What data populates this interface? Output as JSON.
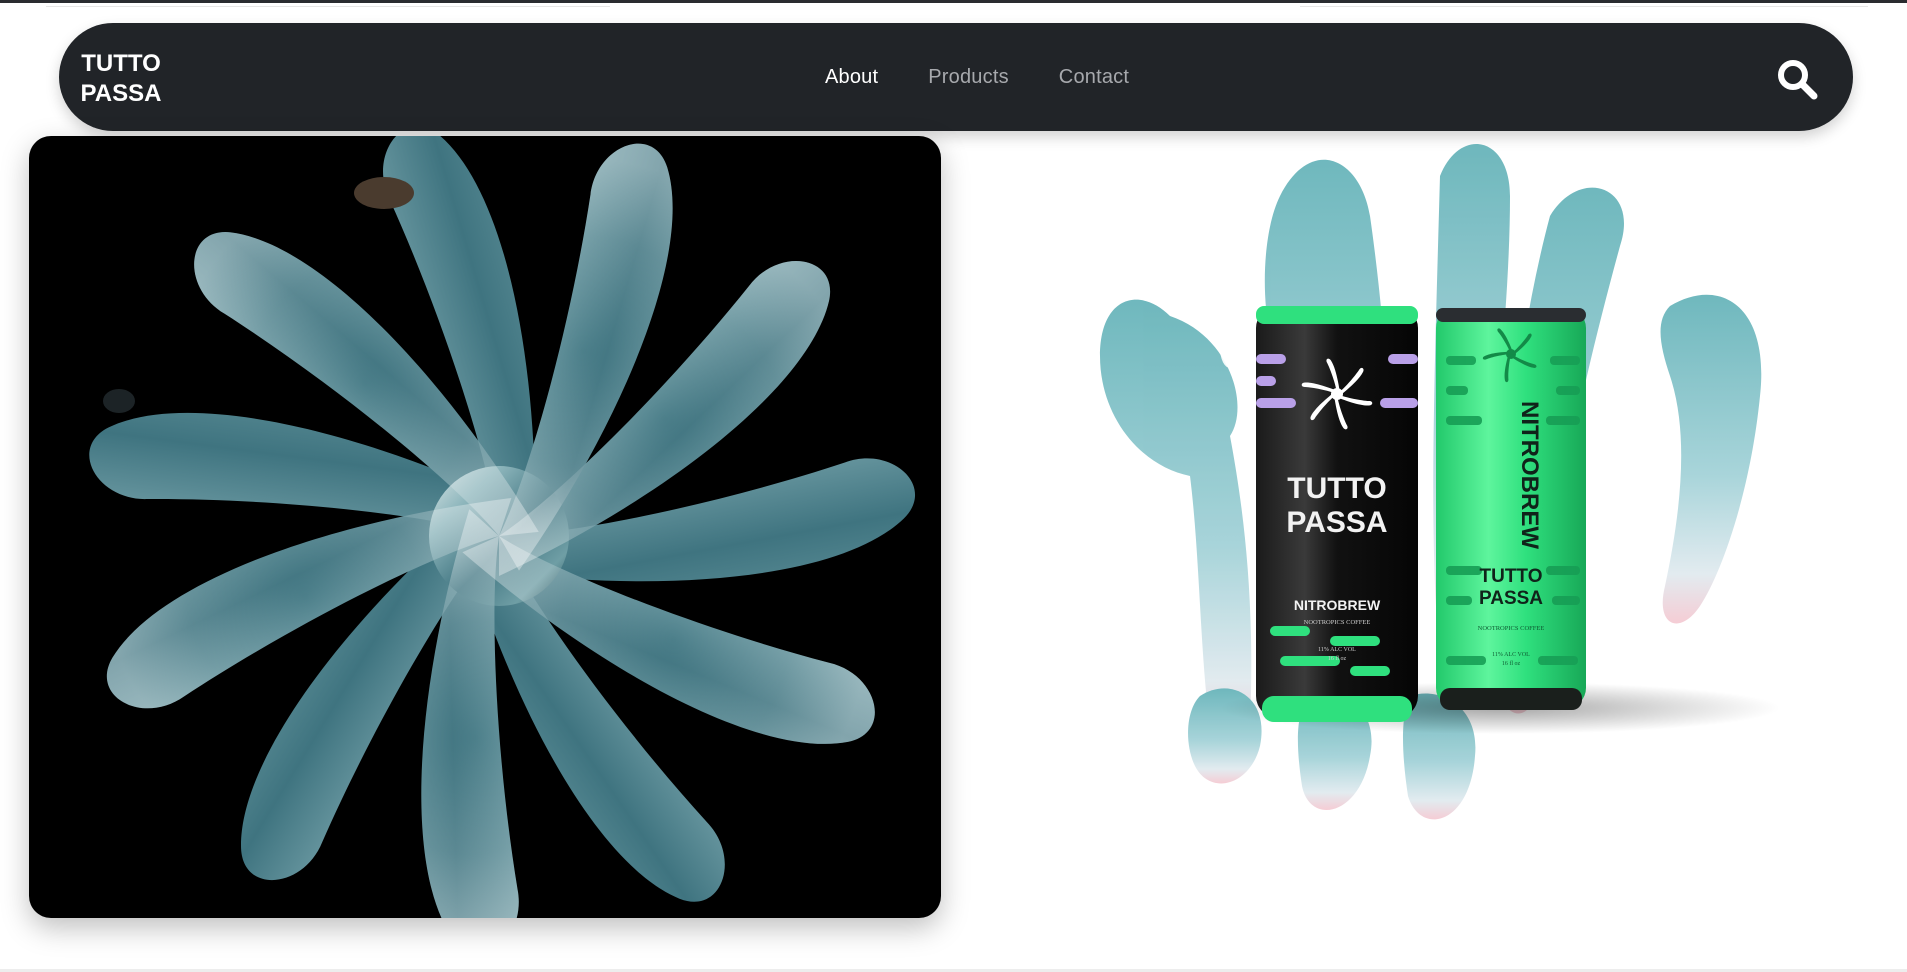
{
  "brand": {
    "logo_line1": "TUTTO",
    "logo_line2": "PASSA"
  },
  "nav": {
    "links": [
      {
        "label": "About",
        "active": true
      },
      {
        "label": "Products",
        "active": false
      },
      {
        "label": "Contact",
        "active": false
      }
    ],
    "search_icon": "search-icon"
  },
  "hero": {
    "icon": "swirl-flower-icon"
  },
  "product": {
    "backdrop_letters": [
      "P",
      "A",
      "S",
      "S",
      "A"
    ],
    "can_black": {
      "brand_line1": "TUTTO",
      "brand_line2": "PASSA",
      "product_name": "NITROBREW",
      "tagline": "NOOTROPICS COFFEE",
      "alc": "11% ALC VOL",
      "volume": "16 fl oz"
    },
    "can_green": {
      "product_name": "NITROBREW",
      "brand_line1": "TUTTO",
      "brand_line2": "PASSA",
      "tagline": "NOOTROPICS COFFEE",
      "alc": "11% ALC VOL",
      "volume": "16 fl oz"
    }
  },
  "colors": {
    "nav_bg": "#212428",
    "nav_text": "#a7a9ad",
    "nav_active": "#ffffff",
    "can_green": "#2fe07e",
    "can_black": "#111111",
    "lilac": "#b9a0e8",
    "teal_letters": "#7dbfc4"
  }
}
